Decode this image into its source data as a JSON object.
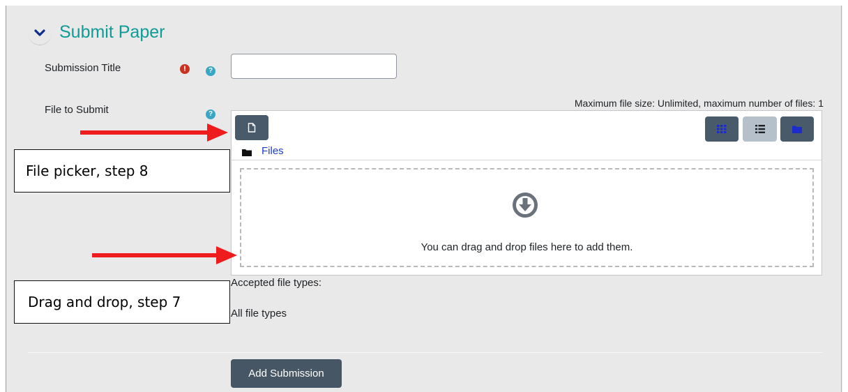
{
  "section": {
    "title": "Submit Paper",
    "toggle_icon": "chevron-down-icon"
  },
  "fields": {
    "submission_title": {
      "label": "Submission Title",
      "value": "",
      "placeholder": "",
      "required_icon": "!",
      "help_icon": "?"
    },
    "file_to_submit": {
      "label": "File to Submit",
      "help_icon": "?"
    }
  },
  "file_manager": {
    "limit_note": "Maximum file size: Unlimited, maximum number of files: 1",
    "breadcrumb": "Files",
    "dropzone_text": "You can drag and drop files here to add them.",
    "buttons": [
      "add-file",
      "view-icons",
      "view-details",
      "view-tree"
    ],
    "active_view": "view-details"
  },
  "accepted": {
    "label": "Accepted file types:",
    "value": "All file types"
  },
  "actions": {
    "submit_label": "Add Submission"
  },
  "annotations": {
    "file_picker": "File picker, step 8",
    "drag_drop": "Drag and drop, step 7",
    "arrow_color": "#ee1c1c"
  },
  "colors": {
    "accent_title": "#0f9c96",
    "button_dark": "#495b6b",
    "button_active": "#b6c0cb",
    "required": "#ca3120",
    "help": "#39a6c5",
    "link": "#1a3fc7"
  }
}
